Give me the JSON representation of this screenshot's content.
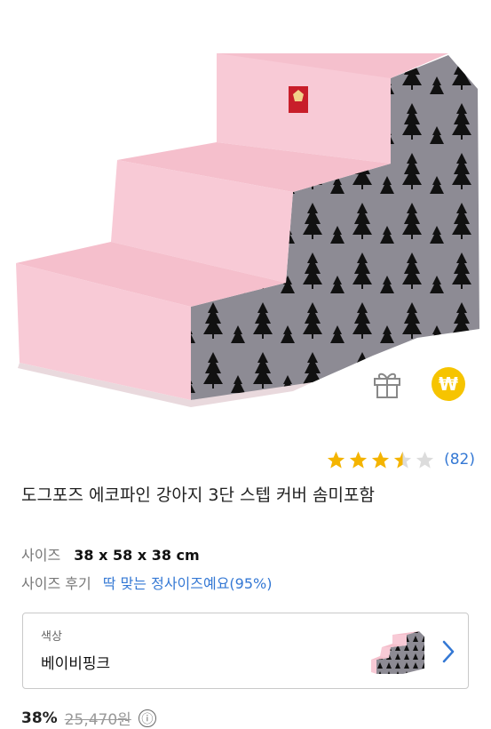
{
  "product": {
    "rating": 3.5,
    "review_count": "(82)",
    "title": "도그포즈 에코파인 강아지 3단 스텝 커버 솜미포함",
    "size_label": "사이즈",
    "size_value": "38 x 58 x 38 cm",
    "review_label": "사이즈 후기",
    "review_value": "딱 맞는 정사이즈예요(95%)",
    "coin_symbol": "₩"
  },
  "option": {
    "label": "색상",
    "value": "베이비핑크"
  },
  "price": {
    "discount": "38%",
    "original": "25,470원",
    "info_icon": "ⓘ"
  },
  "colors": {
    "pink": "#f7c4d0",
    "gray": "#8d8b94",
    "accent_blue": "#3478d4",
    "star": "#f4b400",
    "coin": "#f6c400"
  },
  "icons": {
    "gift": "gift-icon",
    "coin": "won-coin-icon",
    "chevron": "chevron-right-icon",
    "info": "info-icon"
  }
}
